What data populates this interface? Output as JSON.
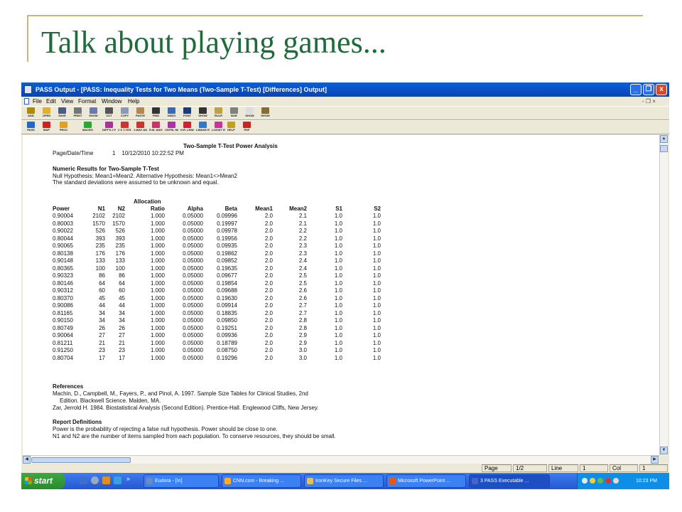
{
  "slide": {
    "title": "Talk about playing games..."
  },
  "window": {
    "title": "PASS Output - [PASS: Inequality Tests for Two Means (Two-Sample T-Test) [Differences] Output]",
    "controls": [
      "_",
      "❐",
      "x"
    ],
    "mdi_controls": "- ❐ ×"
  },
  "menu": [
    "File",
    "Edit",
    "View",
    "Format",
    "Window",
    "Help"
  ],
  "toolbar1": [
    {
      "label": "ADD",
      "icon": "trophy-icon",
      "color": "#b08a00"
    },
    {
      "label": "OPEN",
      "icon": "folder-open-icon",
      "color": "#e0b030"
    },
    {
      "label": "SAVE",
      "icon": "floppy-icon",
      "color": "#4a5a8a"
    },
    {
      "label": "PRINT",
      "icon": "printer-icon",
      "color": "#777777"
    },
    {
      "label": "SHOW",
      "icon": "preview-icon",
      "color": "#6a7ab0"
    },
    {
      "label": "CUT",
      "icon": "scissors-icon",
      "color": "#555555"
    },
    {
      "label": "COPY",
      "icon": "copy-icon",
      "color": "#8899bb"
    },
    {
      "label": "PASTE",
      "icon": "paste-icon",
      "color": "#b08850"
    },
    {
      "label": "FIND",
      "icon": "binoculars-icon",
      "color": "#333333"
    },
    {
      "label": "UNDO",
      "icon": "undo-icon",
      "color": "#3a6ab0"
    },
    {
      "label": "FONT",
      "icon": "font-icon",
      "color": "#1a3a7a"
    },
    {
      "label": "SHOW",
      "icon": "pilcrow-icon",
      "color": "#333333"
    },
    {
      "label": "RULR",
      "icon": "ruler-icon",
      "color": "#c0a040"
    },
    {
      "label": "BAR",
      "icon": "bar-icon",
      "color": "#808080"
    },
    {
      "label": "SHOW",
      "icon": "page-icon",
      "color": "#dddddd"
    },
    {
      "label": "SHOW",
      "icon": "pencil-icon",
      "color": "#8a6a30"
    }
  ],
  "toolbar2": [
    {
      "label": "PASS",
      "icon": "pass-target-icon",
      "color": "#2266cc"
    },
    {
      "label": "MAP",
      "icon": "map-diamond-icon",
      "color": "#cc2222"
    },
    {
      "label": "PROC",
      "icon": "proc-arrow-icon",
      "color": "#e0a020"
    },
    {
      "label": "MACRO",
      "icon": "play-icon",
      "color": "#22aa33"
    },
    {
      "label": "DIFF'S 2 PROP",
      "icon": "dots-icon",
      "color": "#aa3399"
    },
    {
      "label": "2 S T-TEST",
      "icon": "dots-icon",
      "color": "#cc3333"
    },
    {
      "label": "1-WAY ANOVA",
      "icon": "dots-icon",
      "color": "#cc3333"
    },
    {
      "label": "R.M. ANOVA",
      "icon": "dots-icon",
      "color": "#cc3366"
    },
    {
      "label": "CNTRL MC-S",
      "icon": "dots-icon",
      "color": "#aa33aa"
    },
    {
      "label": "H.R. LRNK",
      "icon": "chart-icon",
      "color": "#cc2233"
    },
    {
      "label": "LINEAR REG",
      "icon": "triangle-icon",
      "color": "#3377cc"
    },
    {
      "label": "LOGIST REG",
      "icon": "triangle-icon",
      "color": "#cc3399"
    },
    {
      "label": "HELP",
      "icon": "help-icon",
      "color": "#c0a020"
    },
    {
      "label": "PDF",
      "icon": "pdf-icon",
      "color": "#cc2222"
    }
  ],
  "report": {
    "heading": "Two-Sample T-Test Power Analysis",
    "page_date_label": "Page/Date/Time",
    "page_date_value": "1    10/12/2010 10:22:52 PM",
    "numeric_title": "Numeric Results for Two-Sample T-Test",
    "hypothesis": "Null Hypothesis: Mean1=Mean2. Alternative Hypothesis: Mean1<>Mean2",
    "assumption": "The standard deviations were assumed to be unknown and equal.",
    "allocation_label": "Allocation",
    "columns": [
      "Power",
      "N1",
      "N2",
      "Ratio",
      "Alpha",
      "Beta",
      "Mean1",
      "Mean2",
      "S1",
      "S2"
    ],
    "rows": [
      [
        "0.90004",
        "2102",
        "2102",
        "1.000",
        "0.05000",
        "0.09996",
        "2.0",
        "2.1",
        "1.0",
        "1.0"
      ],
      [
        "0.80003",
        "1570",
        "1570",
        "1.000",
        "0.05000",
        "0.19997",
        "2.0",
        "2.1",
        "1.0",
        "1.0"
      ],
      [
        "0.90022",
        "526",
        "526",
        "1.000",
        "0.05000",
        "0.09978",
        "2.0",
        "2.2",
        "1.0",
        "1.0"
      ],
      [
        "0.80044",
        "393",
        "393",
        "1.000",
        "0.05000",
        "0.19956",
        "2.0",
        "2.2",
        "1.0",
        "1.0"
      ],
      [
        "0.90065",
        "235",
        "235",
        "1.000",
        "0.05000",
        "0.09935",
        "2.0",
        "2.3",
        "1.0",
        "1.0"
      ],
      [
        "0.80138",
        "176",
        "176",
        "1.000",
        "0.05000",
        "0.19862",
        "2.0",
        "2.3",
        "1.0",
        "1.0"
      ],
      [
        "0.90148",
        "133",
        "133",
        "1.000",
        "0.05000",
        "0.09852",
        "2.0",
        "2.4",
        "1.0",
        "1.0"
      ],
      [
        "0.80365",
        "100",
        "100",
        "1.000",
        "0.05000",
        "0.19635",
        "2.0",
        "2.4",
        "1.0",
        "1.0"
      ],
      [
        "0.90323",
        "86",
        "86",
        "1.000",
        "0.05000",
        "0.09677",
        "2.0",
        "2.5",
        "1.0",
        "1.0"
      ],
      [
        "0.80146",
        "64",
        "64",
        "1.000",
        "0.05000",
        "0.19854",
        "2.0",
        "2.5",
        "1.0",
        "1.0"
      ],
      [
        "0.90312",
        "60",
        "60",
        "1.000",
        "0.05000",
        "0.09688",
        "2.0",
        "2.6",
        "1.0",
        "1.0"
      ],
      [
        "0.80370",
        "45",
        "45",
        "1.000",
        "0.05000",
        "0.19630",
        "2.0",
        "2.6",
        "1.0",
        "1.0"
      ],
      [
        "0.90086",
        "44",
        "44",
        "1.000",
        "0.05000",
        "0.09914",
        "2.0",
        "2.7",
        "1.0",
        "1.0"
      ],
      [
        "0.81165",
        "34",
        "34",
        "1.000",
        "0.05000",
        "0.18835",
        "2.0",
        "2.7",
        "1.0",
        "1.0"
      ],
      [
        "0.90150",
        "34",
        "34",
        "1.000",
        "0.05000",
        "0.09850",
        "2.0",
        "2.8",
        "1.0",
        "1.0"
      ],
      [
        "0.80749",
        "26",
        "26",
        "1.000",
        "0.05000",
        "0.19251",
        "2.0",
        "2.8",
        "1.0",
        "1.0"
      ],
      [
        "0.90064",
        "27",
        "27",
        "1.000",
        "0.05000",
        "0.09936",
        "2.0",
        "2.9",
        "1.0",
        "1.0"
      ],
      [
        "0.81211",
        "21",
        "21",
        "1.000",
        "0.05000",
        "0.18789",
        "2.0",
        "2.9",
        "1.0",
        "1.0"
      ],
      [
        "0.91250",
        "23",
        "23",
        "1.000",
        "0.05000",
        "0.08750",
        "2.0",
        "3.0",
        "1.0",
        "1.0"
      ],
      [
        "0.80704",
        "17",
        "17",
        "1.000",
        "0.05000",
        "0.19296",
        "2.0",
        "3.0",
        "1.0",
        "1.0"
      ]
    ],
    "references_title": "References",
    "reference1_line1": "Machin, D., Campbell, M., Fayers, P., and Pinol, A. 1997. Sample Size Tables for Clinical Studies, 2nd",
    "reference1_line2": "Edition. Blackwell Science. Malden, MA.",
    "reference2": "Zar, Jerrold H. 1984. Biostatistical Analysis (Second Edition). Prentice-Hall. Englewood Cliffs, New Jersey.",
    "definitions_title": "Report Definitions",
    "definition1": "Power is the probability of rejecting a false null hypothesis. Power should be close to one.",
    "definition2": "N1 and N2 are the number of items sampled from each population. To conserve resources, they should be small."
  },
  "status": {
    "page_label": "Page",
    "page_value": "1/2",
    "line_label": "Line",
    "line_value": "1",
    "col_label": "Col",
    "col_value": "1"
  },
  "taskbar": {
    "start": "start",
    "chevron": "»",
    "tasks": [
      {
        "label": "Eudora - [In]",
        "color": "#6a8ac8"
      },
      {
        "label": "CNN.com - Breaking ...",
        "color": "#ffaa33"
      },
      {
        "label": "IronKey Secure Files ...",
        "color": "#e0c060"
      },
      {
        "label": "Microsoft PowerPoint ...",
        "color": "#e05a1a"
      },
      {
        "label": "3 PASS Executable ...",
        "color": "#4466cc"
      }
    ],
    "clock": "10:23 PM"
  }
}
